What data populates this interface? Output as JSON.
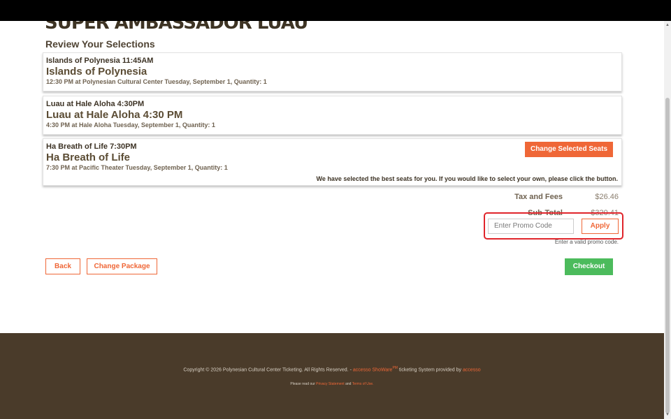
{
  "header": {
    "title": "SUPER AMBASSADOR LUAU"
  },
  "review": {
    "heading": "Review Your Selections"
  },
  "selections": [
    {
      "small_title": "Islands of Polynesia 11:45AM",
      "title": "Islands of Polynesia",
      "details": "12:30 PM at Polynesian Cultural Center Tuesday, September 1, Quantity: 1"
    },
    {
      "small_title": "Luau at Hale Aloha 4:30PM",
      "title": "Luau at Hale Aloha 4:30 PM",
      "details": "4:30 PM at Hale Aloha Tuesday, September 1, Quantity: 1"
    },
    {
      "small_title": "Ha Breath of Life 7:30PM",
      "title": "Ha Breath of Life",
      "details": "7:30 PM at Pacific Theater Tuesday, September 1, Quantity: 1",
      "change_seats_label": "Change Selected Seats",
      "seat_note": "We have selected the best seats for you. If you would like to select your own, please click the button."
    }
  ],
  "totals": {
    "tax_label": "Tax and Fees",
    "tax_value": "$26.46",
    "subtotal_label": "Sub-Total",
    "subtotal_value": "$320.41"
  },
  "promo": {
    "placeholder": "Enter Promo Code",
    "apply_label": "Apply",
    "hint": "Enter a valid promo code."
  },
  "actions": {
    "back_label": "Back",
    "change_package_label": "Change Package",
    "checkout_label": "Checkout"
  },
  "footer": {
    "copyright": "Copyright © 2026 Polynesian Cultural Center Ticketing. All Rights Reserved. -",
    "brand_link": "accesso ShoWare",
    "brand_suffix": "PM",
    "system_text": " ticketing System provided by ",
    "provider_link": "accesso",
    "read_prefix": "Please read our ",
    "privacy_link": "Privacy Statement",
    "and_text": " and ",
    "terms_link": "Terms of Use."
  },
  "colors": {
    "accent": "#ef6737",
    "checkout": "#4cbb5c",
    "footer_bg": "#4a3b2a",
    "highlight": "#e0252b"
  }
}
